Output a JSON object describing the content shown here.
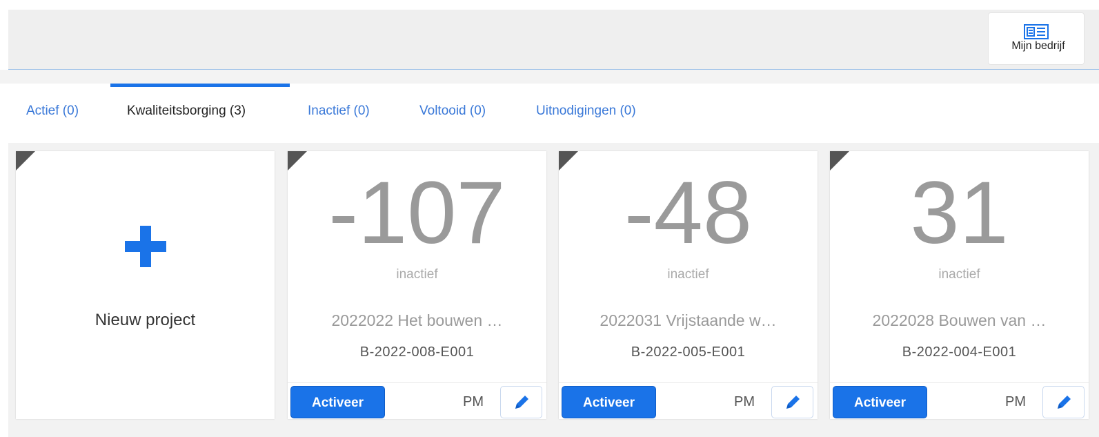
{
  "header": {
    "company_button_label": "Mijn bedrijf",
    "company_icon": "company-card-icon"
  },
  "tabs": [
    {
      "label": "Actief (0)",
      "active": false
    },
    {
      "label": "Kwaliteitsborging (3)",
      "active": true
    },
    {
      "label": "Inactief (0)",
      "active": false
    },
    {
      "label": "Voltooid (0)",
      "active": false
    },
    {
      "label": "Uitnodigingen (0)",
      "active": false
    }
  ],
  "new_project": {
    "icon": "plus-icon",
    "label": "Nieuw project"
  },
  "projects": [
    {
      "days": "-107",
      "status": "inactief",
      "title": "2022022 Het bouwen …",
      "code": "B-2022-008-E001",
      "activate_label": "Activeer",
      "role": "PM"
    },
    {
      "days": "-48",
      "status": "inactief",
      "title": "2022031 Vrijstaande w…",
      "code": "B-2022-005-E001",
      "activate_label": "Activeer",
      "role": "PM"
    },
    {
      "days": "31",
      "status": "inactief",
      "title": "2022028 Bouwen van …",
      "code": "B-2022-004-E001",
      "activate_label": "Activeer",
      "role": "PM"
    }
  ],
  "colors": {
    "accent": "#1a73e8",
    "tab_link": "#3978d8",
    "big_number": "#9a9a9a"
  }
}
